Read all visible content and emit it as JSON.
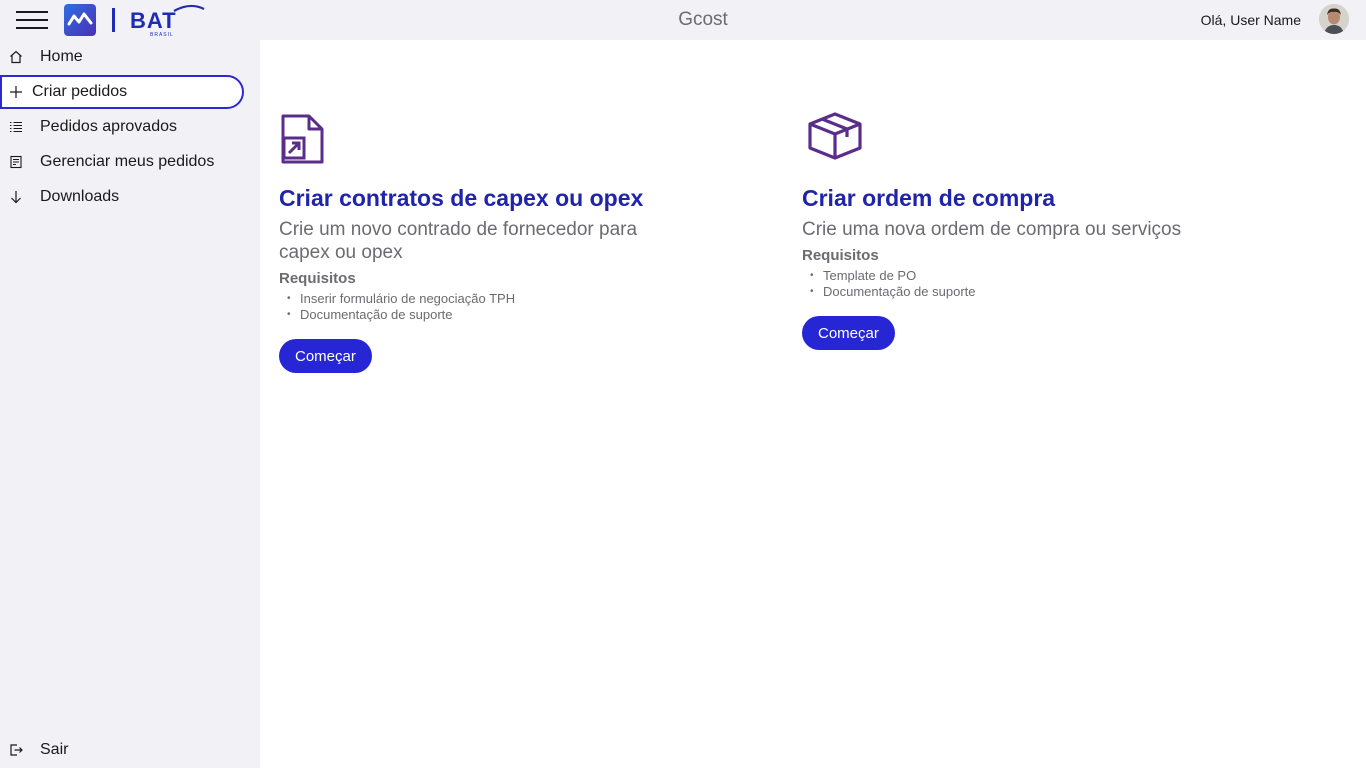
{
  "header": {
    "app_title": "Gcost",
    "greeting": "Olá, User Name",
    "brand_text": "BAT",
    "brand_subtext": "BRASIL"
  },
  "sidebar": {
    "items": [
      {
        "label": "Home",
        "icon": "home-icon"
      },
      {
        "label": "Criar pedidos",
        "icon": "plus-icon",
        "active": true
      },
      {
        "label": "Pedidos aprovados",
        "icon": "list-icon"
      },
      {
        "label": "Gerenciar meus pedidos",
        "icon": "clipboard-icon"
      },
      {
        "label": "Downloads",
        "icon": "arrow-down-icon"
      }
    ],
    "logout": {
      "label": "Sair",
      "icon": "logout-icon"
    }
  },
  "cards": [
    {
      "icon": "document-link-icon",
      "title": "Criar contratos de capex ou opex",
      "description": "Crie um novo contrado de fornecedor para capex ou opex",
      "requirements_title": "Requisitos",
      "requirements": [
        "Inserir formulário de negociação TPH",
        "Documentação de suporte"
      ],
      "button": "Começar"
    },
    {
      "icon": "box-icon",
      "title": "Criar ordem de compra",
      "description": "Crie uma nova ordem de compra ou serviços",
      "requirements_title": "Requisitos",
      "requirements": [
        "Template de PO",
        "Documentação de suporte"
      ],
      "button": "Começar"
    }
  ],
  "colors": {
    "accent": "#2626d4",
    "title": "#1f24a8",
    "icon": "#5a2d8a",
    "muted": "#6b6b72"
  }
}
